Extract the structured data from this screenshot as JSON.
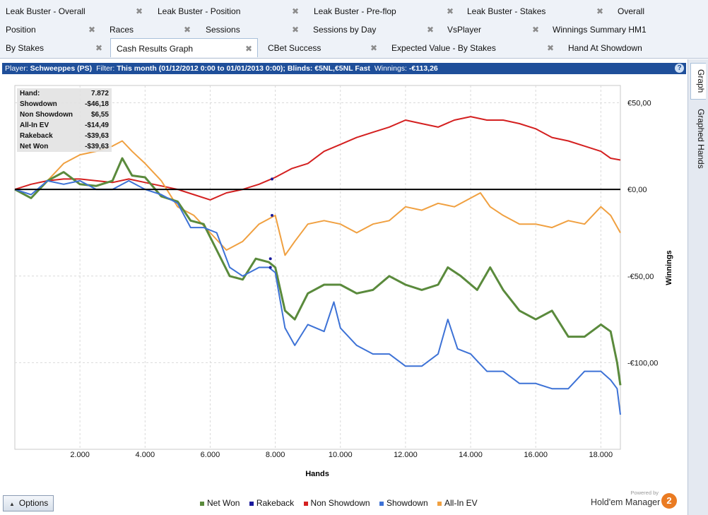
{
  "tabs": {
    "row1": [
      {
        "label": "Leak Buster - Overall"
      },
      {
        "label": "Leak Buster - Position"
      },
      {
        "label": "Leak Buster - Pre-flop"
      },
      {
        "label": "Leak Buster - Stakes"
      },
      {
        "label": "Overall"
      }
    ],
    "row2": [
      {
        "label": "Position"
      },
      {
        "label": "Races"
      },
      {
        "label": "Sessions"
      },
      {
        "label": "Sessions by Day"
      },
      {
        "label": "VsPlayer"
      },
      {
        "label": "Winnings Summary HM1"
      }
    ],
    "row3": [
      {
        "label": "By Stakes"
      },
      {
        "label": "Cash Results Graph",
        "active": true
      },
      {
        "label": "CBet Success"
      },
      {
        "label": "Expected Value - By Stakes"
      },
      {
        "label": "Hand At Showdown"
      }
    ],
    "close_glyph": "✖"
  },
  "header": {
    "player_label": "Player:",
    "player": "Schweeppes (PS)",
    "filter_label": "Filter:",
    "filter": "This month (01/12/2012 0:00 to 01/01/2013 0:00); Blinds: €5NL,€5NL Fast",
    "winnings_label": "Winnings:",
    "winnings": "-€113,26",
    "help": "?"
  },
  "side_tabs": [
    {
      "label": "Graph",
      "active": true
    },
    {
      "label": "Graphed Hands"
    }
  ],
  "stats": [
    {
      "label": "Hand:",
      "value": "7.872"
    },
    {
      "label": "Showdown",
      "value": "-$46,18"
    },
    {
      "label": "Non Showdown",
      "value": "$6,55"
    },
    {
      "label": "All-In EV",
      "value": "-$14,49"
    },
    {
      "label": "Rakeback",
      "value": "-$39,63"
    },
    {
      "label": "Net Won",
      "value": "-$39,63"
    }
  ],
  "footer": {
    "options_label": "Options",
    "brand_small": "Powered by",
    "brand_name": "Hold'em Manager",
    "brand_logo": "2"
  },
  "chart_data": {
    "type": "line",
    "xlabel": "Hands",
    "ylabel": "Winnings",
    "xlim": [
      0,
      18600
    ],
    "ylim": [
      -150,
      60
    ],
    "x_ticks": [
      2000,
      4000,
      6000,
      8000,
      10000,
      12000,
      14000,
      16000,
      18000
    ],
    "x_tick_labels": [
      "2.000",
      "4.000",
      "6.000",
      "8.000",
      "10.000",
      "12.000",
      "14.000",
      "16.000",
      "18.000"
    ],
    "y_ticks": [
      50,
      0,
      -50,
      -100
    ],
    "y_tick_labels": [
      "€50,00",
      "€0,00",
      "-€50,00",
      "-€100,00"
    ],
    "grid": true,
    "legend_position": "bottom",
    "series": [
      {
        "name": "Net Won",
        "color": "#5a8a3c",
        "width": 3,
        "x": [
          0,
          500,
          1000,
          1500,
          2000,
          2500,
          3000,
          3300,
          3600,
          4000,
          4500,
          5000,
          5400,
          5800,
          6200,
          6600,
          7000,
          7400,
          7800,
          8000,
          8300,
          8600,
          9000,
          9500,
          10000,
          10500,
          11000,
          11500,
          12000,
          12500,
          13000,
          13300,
          13700,
          14200,
          14600,
          15000,
          15500,
          16000,
          16500,
          17000,
          17500,
          18000,
          18300,
          18500,
          18600
        ],
        "y": [
          0,
          -5,
          5,
          10,
          3,
          2,
          5,
          18,
          8,
          7,
          -4,
          -7,
          -18,
          -20,
          -35,
          -50,
          -52,
          -40,
          -42,
          -45,
          -70,
          -75,
          -60,
          -55,
          -55,
          -60,
          -58,
          -50,
          -55,
          -58,
          -55,
          -45,
          -50,
          -58,
          -45,
          -58,
          -70,
          -75,
          -70,
          -85,
          -85,
          -78,
          -82,
          -100,
          -113
        ]
      },
      {
        "name": "Rakeback",
        "color": "#1a1a9c",
        "width": 2,
        "x": [
          0,
          18600
        ],
        "y": [
          0,
          0
        ]
      },
      {
        "name": "Non Showdown",
        "color": "#d42020",
        "width": 2,
        "x": [
          0,
          500,
          1000,
          1500,
          2000,
          2500,
          3000,
          3500,
          4000,
          4500,
          5000,
          5500,
          6000,
          6500,
          7000,
          7500,
          8000,
          8500,
          9000,
          9500,
          10000,
          10500,
          11000,
          11500,
          12000,
          12500,
          13000,
          13500,
          14000,
          14500,
          15000,
          15500,
          16000,
          16500,
          17000,
          17500,
          18000,
          18300,
          18600
        ],
        "y": [
          0,
          3,
          5,
          6,
          6,
          5,
          4,
          6,
          4,
          2,
          0,
          -3,
          -6,
          -2,
          0,
          3,
          7,
          12,
          15,
          22,
          26,
          30,
          33,
          36,
          40,
          38,
          36,
          40,
          42,
          40,
          40,
          38,
          35,
          30,
          28,
          25,
          22,
          18,
          17
        ]
      },
      {
        "name": "Showdown",
        "color": "#3d72d6",
        "width": 2,
        "x": [
          0,
          500,
          1000,
          1500,
          2000,
          2500,
          3000,
          3500,
          4000,
          4500,
          5000,
          5400,
          5800,
          6200,
          6600,
          7000,
          7500,
          7800,
          8000,
          8300,
          8600,
          9000,
          9500,
          9800,
          10000,
          10500,
          11000,
          11500,
          12000,
          12500,
          13000,
          13300,
          13600,
          14000,
          14500,
          15000,
          15500,
          16000,
          16500,
          17000,
          17500,
          18000,
          18300,
          18500,
          18600
        ],
        "y": [
          0,
          -3,
          5,
          3,
          5,
          0,
          0,
          5,
          0,
          -3,
          -8,
          -22,
          -22,
          -25,
          -45,
          -50,
          -45,
          -45,
          -48,
          -80,
          -90,
          -78,
          -82,
          -65,
          -80,
          -90,
          -95,
          -95,
          -102,
          -102,
          -95,
          -75,
          -92,
          -95,
          -105,
          -105,
          -112,
          -112,
          -115,
          -115,
          -105,
          -105,
          -110,
          -115,
          -130
        ]
      },
      {
        "name": "All-In EV",
        "color": "#f0a040",
        "width": 2,
        "x": [
          0,
          500,
          1000,
          1500,
          2000,
          2500,
          3000,
          3300,
          3600,
          4000,
          4500,
          5000,
          5500,
          6000,
          6500,
          7000,
          7500,
          8000,
          8300,
          8600,
          9000,
          9500,
          10000,
          10500,
          11000,
          11500,
          12000,
          12500,
          13000,
          13500,
          14000,
          14300,
          14600,
          15000,
          15500,
          16000,
          16500,
          17000,
          17500,
          18000,
          18300,
          18600
        ],
        "y": [
          0,
          -5,
          5,
          15,
          20,
          22,
          25,
          28,
          22,
          15,
          5,
          -10,
          -15,
          -25,
          -35,
          -30,
          -20,
          -15,
          -38,
          -30,
          -20,
          -18,
          -20,
          -25,
          -20,
          -18,
          -10,
          -12,
          -8,
          -10,
          -5,
          -2,
          -10,
          -15,
          -20,
          -20,
          -22,
          -18,
          -20,
          -10,
          -15,
          -25
        ]
      }
    ],
    "markers": [
      {
        "series": "Rakeback",
        "x": 7900,
        "y": 6
      },
      {
        "series": "Rakeback",
        "x": 7900,
        "y": -15
      },
      {
        "series": "Rakeback",
        "x": 7850,
        "y": -40
      },
      {
        "series": "Rakeback",
        "x": 7850,
        "y": -45
      }
    ]
  }
}
